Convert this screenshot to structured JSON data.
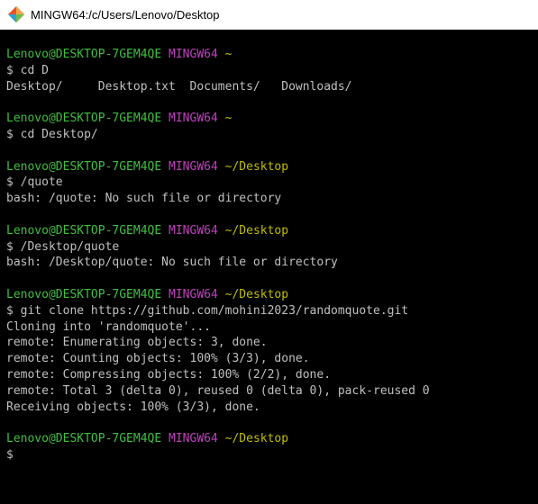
{
  "window": {
    "title": "MINGW64:/c/Users/Lenovo/Desktop",
    "icon": "git-bash-icon"
  },
  "colors": {
    "background": "#000000",
    "text": "#c0c0c0",
    "user_host": "#3fbf3f",
    "shell_name": "#bf40bf",
    "path": "#bfbf00"
  },
  "terminal": {
    "blocks": [
      {
        "prompt": {
          "user": "Lenovo@DESKTOP-7GEM4QE",
          "shell": "MINGW64",
          "path": "~"
        },
        "command": "$ cd D",
        "output": [
          "Desktop/     Desktop.txt  Documents/   Downloads/"
        ]
      },
      {
        "prompt": {
          "user": "Lenovo@DESKTOP-7GEM4QE",
          "shell": "MINGW64",
          "path": "~"
        },
        "command": "$ cd Desktop/",
        "output": []
      },
      {
        "prompt": {
          "user": "Lenovo@DESKTOP-7GEM4QE",
          "shell": "MINGW64",
          "path": "~/Desktop"
        },
        "command": "$ /quote",
        "output": [
          "bash: /quote: No such file or directory"
        ]
      },
      {
        "prompt": {
          "user": "Lenovo@DESKTOP-7GEM4QE",
          "shell": "MINGW64",
          "path": "~/Desktop"
        },
        "command": "$ /Desktop/quote",
        "output": [
          "bash: /Desktop/quote: No such file or directory"
        ]
      },
      {
        "prompt": {
          "user": "Lenovo@DESKTOP-7GEM4QE",
          "shell": "MINGW64",
          "path": "~/Desktop"
        },
        "command": "$ git clone https://github.com/mohini2023/randomquote.git",
        "output": [
          "Cloning into 'randomquote'...",
          "remote: Enumerating objects: 3, done.",
          "remote: Counting objects: 100% (3/3), done.",
          "remote: Compressing objects: 100% (2/2), done.",
          "remote: Total 3 (delta 0), reused 0 (delta 0), pack-reused 0",
          "Receiving objects: 100% (3/3), done."
        ]
      },
      {
        "prompt": {
          "user": "Lenovo@DESKTOP-7GEM4QE",
          "shell": "MINGW64",
          "path": "~/Desktop"
        },
        "command": "$",
        "output": []
      }
    ]
  }
}
